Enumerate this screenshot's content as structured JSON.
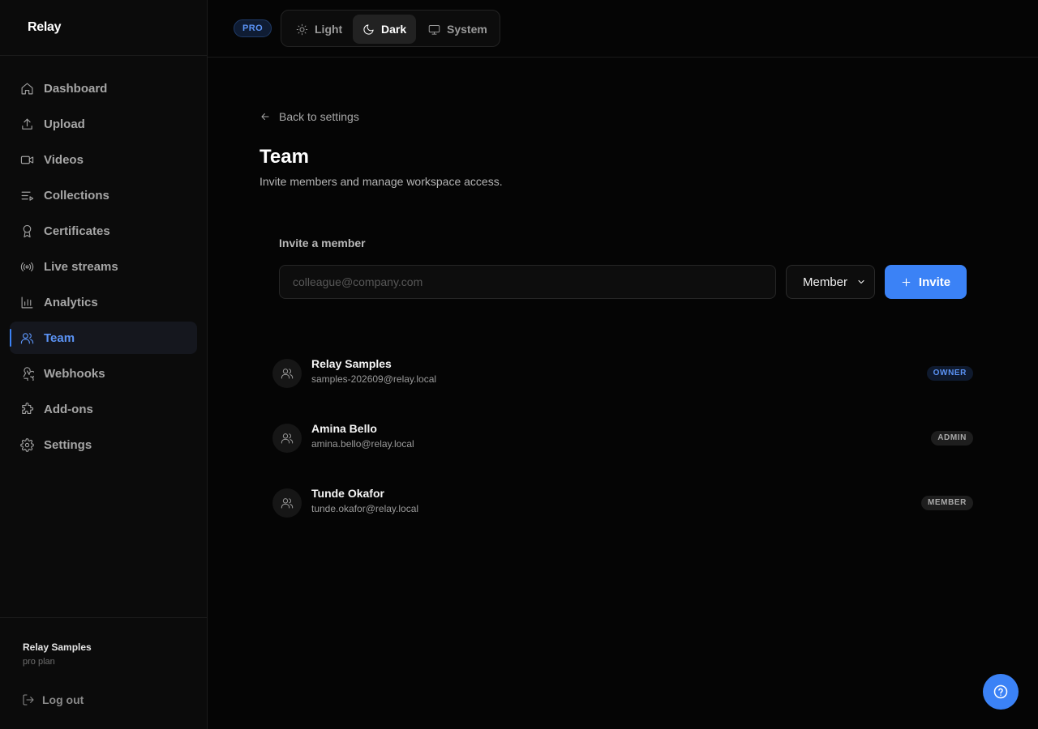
{
  "app": {
    "logo": "Relay"
  },
  "sidebar": {
    "items": [
      {
        "label": "Dashboard",
        "icon": "home-icon",
        "active": false
      },
      {
        "label": "Upload",
        "icon": "upload-icon",
        "active": false
      },
      {
        "label": "Videos",
        "icon": "video-icon",
        "active": false
      },
      {
        "label": "Collections",
        "icon": "list-icon",
        "active": false
      },
      {
        "label": "Certificates",
        "icon": "award-icon",
        "active": false
      },
      {
        "label": "Live streams",
        "icon": "broadcast-icon",
        "active": false
      },
      {
        "label": "Analytics",
        "icon": "bar-chart-icon",
        "active": false
      },
      {
        "label": "Team",
        "icon": "users-icon",
        "active": true
      },
      {
        "label": "Webhooks",
        "icon": "webhook-icon",
        "active": false
      },
      {
        "label": "Add-ons",
        "icon": "puzzle-icon",
        "active": false
      },
      {
        "label": "Settings",
        "icon": "gear-icon",
        "active": false
      }
    ],
    "user": {
      "name": "Relay Samples",
      "plan": "pro plan"
    },
    "logout_label": "Log out"
  },
  "header": {
    "plan_badge": "PRO",
    "theme": {
      "options": [
        "Light",
        "Dark",
        "System"
      ],
      "selected": "Dark"
    }
  },
  "main": {
    "back_label": "Back to settings",
    "title": "Team",
    "subtitle": "Invite members and manage workspace access.",
    "invite": {
      "label": "Invite a member",
      "email_placeholder": "colleague@company.com",
      "email_value": "",
      "role_selected": "Member",
      "button_label": "Invite"
    },
    "members": [
      {
        "name": "Relay Samples",
        "email": "samples-202609@relay.local",
        "role": "OWNER"
      },
      {
        "name": "Amina Bello",
        "email": "amina.bello@relay.local",
        "role": "ADMIN"
      },
      {
        "name": "Tunde Okafor",
        "email": "tunde.okafor@relay.local",
        "role": "MEMBER"
      }
    ]
  },
  "colors": {
    "accent": "#3b82f6",
    "background": "#050505",
    "sidebar": "#0b0b0b"
  },
  "help": {
    "icon": "help-circle-icon"
  }
}
